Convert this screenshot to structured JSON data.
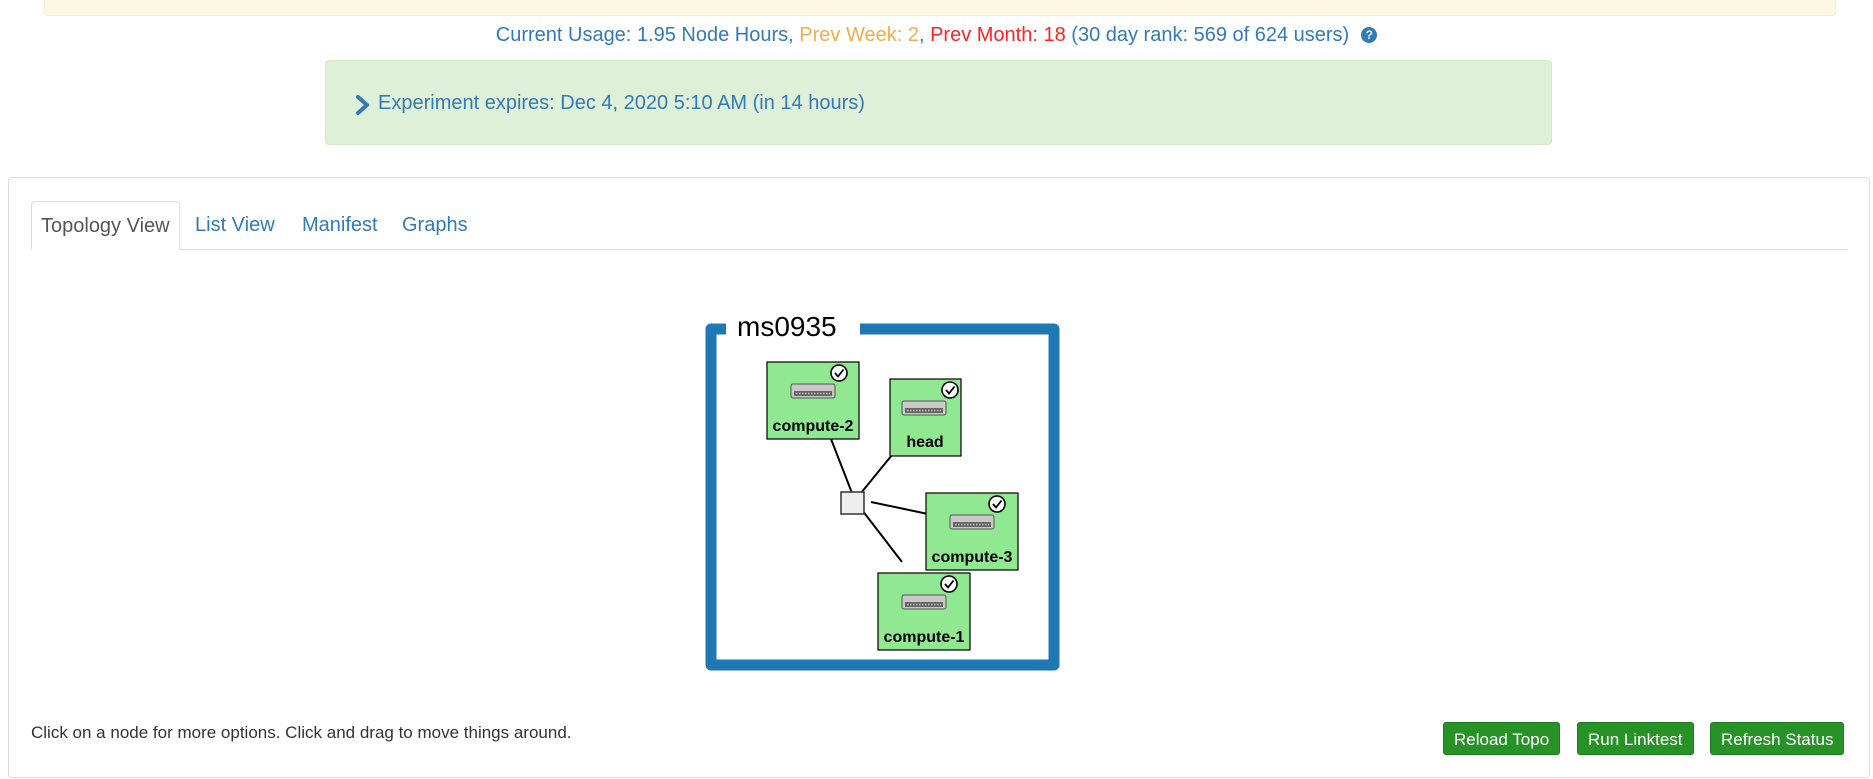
{
  "usage": {
    "current_label": "Current Usage:",
    "current_value": "1.95 Node Hours",
    "sep1": ",",
    "prev_week": "Prev Week: 2",
    "sep2": ",",
    "prev_month_label": "Prev Month:",
    "prev_month_value": "18",
    "rank": "(30 day rank: 569 of 624 users)",
    "help_glyph": "?"
  },
  "expiration": {
    "text": "Experiment expires: Dec 4, 2020 5:10 AM (in 14 hours)"
  },
  "tabs": [
    {
      "label": "Topology View",
      "active": true
    },
    {
      "label": "List View",
      "active": false
    },
    {
      "label": "Manifest",
      "active": false
    },
    {
      "label": "Graphs",
      "active": false
    }
  ],
  "topology": {
    "experiment_name": "ms0935",
    "nodes": [
      {
        "label": "compute-2",
        "status": "ready"
      },
      {
        "label": "head",
        "status": "ready"
      },
      {
        "label": "compute-3",
        "status": "ready"
      },
      {
        "label": "compute-1",
        "status": "ready"
      }
    ],
    "node_icon": "server-icon",
    "status_icon": "check-circle-icon",
    "link_icon": "lan-switch-icon"
  },
  "footer": {
    "hint": "Click on a node for more options. Click and drag to move things around.",
    "buttons": [
      "Reload Topo",
      "Run Linktest",
      "Refresh Status"
    ]
  },
  "colors": {
    "accent": "#337ab7",
    "expire_bg": "#dff0d8",
    "topo_border": "#1f78b4",
    "node_fill": "#90e890",
    "button": "#279327",
    "prev_week": "#f0ad4e",
    "prev_month": "#ff2222"
  }
}
